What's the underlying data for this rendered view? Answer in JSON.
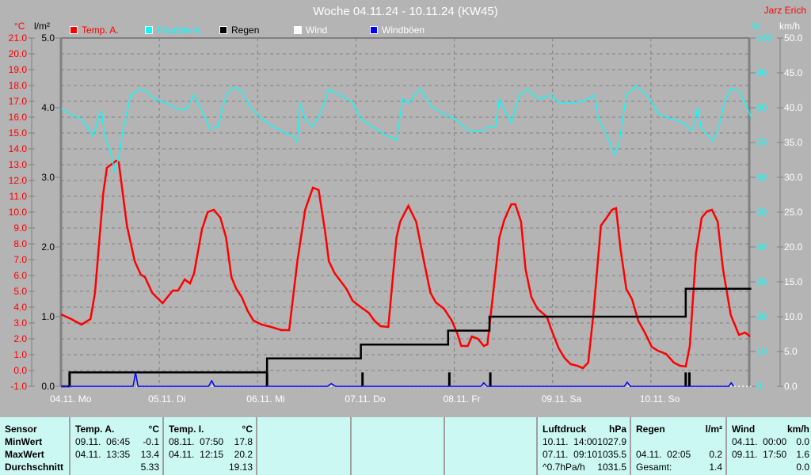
{
  "header": {
    "title": "Woche 04.11.24 - 10.11.24 (KW45)",
    "author": "Jarz Erich"
  },
  "legend": [
    {
      "label": "Temp. A.",
      "color": "#ff0000"
    },
    {
      "label": "Feuchte A.",
      "color": "#00ffff"
    },
    {
      "label": "Regen",
      "color": "#000000"
    },
    {
      "label": "Wind",
      "color": "#ffffff"
    },
    {
      "label": "Windböen",
      "color": "#0000ff"
    }
  ],
  "units": {
    "temp": "°C",
    "rain": "l/m²",
    "humidity": "%",
    "wind": "km/h"
  },
  "chart_data": {
    "type": "line",
    "title": "Woche 04.11.24 - 10.11.24 (KW45)",
    "x_unit": "hours since 04.11. 00:00",
    "xlim": [
      0,
      168
    ],
    "x_tick_labels": [
      "04.11. Mo",
      "05.11. Di",
      "06.11. Mi",
      "07.11. Do",
      "08.11. Fr",
      "09.11. Sa",
      "10.11. So"
    ],
    "axes": {
      "temp": {
        "range": [
          -1,
          21
        ],
        "ticks": [
          "-1.0",
          "0.0",
          "1.0",
          "2.0",
          "3.0",
          "4.0",
          "5.0",
          "6.0",
          "7.0",
          "8.0",
          "9.0",
          "10.0",
          "11.0",
          "12.0",
          "13.0",
          "14.0",
          "15.0",
          "16.0",
          "17.0",
          "18.0",
          "19.0",
          "20.0",
          "21.0"
        ]
      },
      "rain": {
        "range": [
          0,
          5
        ],
        "ticks": [
          "0.0",
          "1.0",
          "2.0",
          "3.0",
          "4.0",
          "5.0"
        ]
      },
      "humidity": {
        "range": [
          0,
          100
        ],
        "ticks": [
          "0",
          "10",
          "20",
          "30",
          "40",
          "50",
          "60",
          "70",
          "80",
          "90",
          "100"
        ]
      },
      "wind": {
        "range": [
          0,
          50
        ],
        "ticks": [
          "0.0",
          "5.0",
          "10.0",
          "15.0",
          "20.0",
          "25.0",
          "30.0",
          "35.0",
          "40.0",
          "45.0",
          "50.0"
        ]
      }
    },
    "grid": true,
    "series": [
      {
        "name": "Temp. A.",
        "axis": "temp",
        "color": "#ff0000",
        "points": [
          [
            0,
            3.55
          ],
          [
            2.5,
            3.25
          ],
          [
            5,
            2.9
          ],
          [
            7.2,
            3.25
          ],
          [
            8.3,
            4.9
          ],
          [
            10.3,
            11.15
          ],
          [
            11.2,
            12.8
          ],
          [
            13.5,
            13.25
          ],
          [
            14.1,
            13.15
          ],
          [
            16.1,
            9.15
          ],
          [
            18,
            6.9
          ],
          [
            19.5,
            6.05
          ],
          [
            20.5,
            5.9
          ],
          [
            22.3,
            4.9
          ],
          [
            24.8,
            4.25
          ],
          [
            27.3,
            5.05
          ],
          [
            28.6,
            5.05
          ],
          [
            30.2,
            5.75
          ],
          [
            31.5,
            5.5
          ],
          [
            32.5,
            6.15
          ],
          [
            34.4,
            8.9
          ],
          [
            35.8,
            10
          ],
          [
            37.3,
            10.15
          ],
          [
            38.9,
            9.65
          ],
          [
            40.3,
            8.4
          ],
          [
            41.6,
            5.9
          ],
          [
            42.8,
            5.15
          ],
          [
            44.1,
            4.65
          ],
          [
            45.5,
            3.8
          ],
          [
            47,
            3.15
          ],
          [
            49,
            2.9
          ],
          [
            51.3,
            2.75
          ],
          [
            53.8,
            2.55
          ],
          [
            55.7,
            2.55
          ],
          [
            57.7,
            6.9
          ],
          [
            59.6,
            10.15
          ],
          [
            61.5,
            11.55
          ],
          [
            62.9,
            11.4
          ],
          [
            64.4,
            8.9
          ],
          [
            65.4,
            6.9
          ],
          [
            66.8,
            6.15
          ],
          [
            69.7,
            5.15
          ],
          [
            71.2,
            4.4
          ],
          [
            73.2,
            4
          ],
          [
            75.1,
            3.65
          ],
          [
            76.5,
            3.15
          ],
          [
            78,
            2.8
          ],
          [
            79.9,
            2.75
          ],
          [
            81.9,
            8.4
          ],
          [
            82.8,
            9.4
          ],
          [
            84.8,
            10.4
          ],
          [
            86.7,
            9.4
          ],
          [
            88.6,
            6.9
          ],
          [
            90.2,
            4.9
          ],
          [
            91.5,
            4.3
          ],
          [
            93.5,
            3.9
          ],
          [
            95.4,
            3.15
          ],
          [
            96.8,
            2.3
          ],
          [
            97.7,
            1.55
          ],
          [
            99.3,
            1.55
          ],
          [
            100.3,
            2.15
          ],
          [
            101.8,
            2
          ],
          [
            103.2,
            1.55
          ],
          [
            104.1,
            1.65
          ],
          [
            105.5,
            4.9
          ],
          [
            107,
            8.4
          ],
          [
            108.2,
            9.5
          ],
          [
            109.9,
            10.5
          ],
          [
            110.9,
            10.5
          ],
          [
            112.3,
            9.4
          ],
          [
            113.4,
            6.4
          ],
          [
            114.8,
            4.65
          ],
          [
            116.3,
            3.9
          ],
          [
            118.6,
            3.4
          ],
          [
            119.6,
            2.65
          ],
          [
            121.5,
            1.4
          ],
          [
            122.9,
            0.8
          ],
          [
            124.4,
            0.4
          ],
          [
            126,
            0.3
          ],
          [
            127.4,
            0.15
          ],
          [
            128.7,
            0.5
          ],
          [
            129.9,
            3.4
          ],
          [
            131.8,
            9.15
          ],
          [
            133.2,
            9.65
          ],
          [
            134.5,
            10.15
          ],
          [
            135.5,
            10.25
          ],
          [
            136.6,
            7.65
          ],
          [
            138,
            5.15
          ],
          [
            139.4,
            4.5
          ],
          [
            140.9,
            3.15
          ],
          [
            142.5,
            2.4
          ],
          [
            144.2,
            1.5
          ],
          [
            145.7,
            1.25
          ],
          [
            147.7,
            1.05
          ],
          [
            149.6,
            0.5
          ],
          [
            151.1,
            0.3
          ],
          [
            152.5,
            0.25
          ],
          [
            153.5,
            1.55
          ],
          [
            155,
            7.4
          ],
          [
            156.4,
            9.65
          ],
          [
            157.7,
            10.05
          ],
          [
            158.9,
            10.15
          ],
          [
            160.3,
            9.4
          ],
          [
            161.6,
            6.4
          ],
          [
            163.5,
            3.5
          ],
          [
            165.5,
            2.25
          ],
          [
            167,
            2.4
          ],
          [
            168.2,
            2.15
          ]
        ]
      },
      {
        "name": "Feuchte A.",
        "axis": "humidity",
        "color": "#00ffff",
        "points": [
          [
            0,
            79.8
          ],
          [
            2.5,
            78
          ],
          [
            5,
            76.8
          ],
          [
            6.4,
            74.5
          ],
          [
            7.9,
            71.8
          ],
          [
            9.3,
            78
          ],
          [
            9.9,
            79
          ],
          [
            10.6,
            72.3
          ],
          [
            12.2,
            66.6
          ],
          [
            13.1,
            62
          ],
          [
            14.1,
            65.5
          ],
          [
            15.1,
            73.4
          ],
          [
            17,
            83.6
          ],
          [
            19,
            85.2
          ],
          [
            20.9,
            84.8
          ],
          [
            22.8,
            82.5
          ],
          [
            25.7,
            81.4
          ],
          [
            28.6,
            79.5
          ],
          [
            30.6,
            79.5
          ],
          [
            32.5,
            83.6
          ],
          [
            34.4,
            79
          ],
          [
            36.4,
            73.9
          ],
          [
            38.3,
            74.5
          ],
          [
            40.3,
            83.6
          ],
          [
            42.2,
            85.9
          ],
          [
            44.1,
            84.8
          ],
          [
            46.1,
            80.2
          ],
          [
            49,
            76.8
          ],
          [
            51.9,
            74.5
          ],
          [
            54.8,
            72.7
          ],
          [
            56.7,
            71.8
          ],
          [
            57.7,
            70
          ],
          [
            58.3,
            81.4
          ],
          [
            59.6,
            76.8
          ],
          [
            61.5,
            74.5
          ],
          [
            63.5,
            79
          ],
          [
            65.4,
            85.2
          ],
          [
            68.3,
            83.6
          ],
          [
            71.2,
            81.4
          ],
          [
            73.2,
            76.8
          ],
          [
            76.1,
            74.5
          ],
          [
            79,
            72.3
          ],
          [
            81.9,
            70.7
          ],
          [
            83.4,
            82.5
          ],
          [
            84.8,
            81.4
          ],
          [
            87.7,
            85.5
          ],
          [
            90.6,
            80.2
          ],
          [
            93.5,
            78
          ],
          [
            96.4,
            76.8
          ],
          [
            99.3,
            73.4
          ],
          [
            103.2,
            73.4
          ],
          [
            104.1,
            74.5
          ],
          [
            106.1,
            74.5
          ],
          [
            107,
            82.5
          ],
          [
            108.4,
            79
          ],
          [
            109.9,
            75.7
          ],
          [
            111.9,
            83.6
          ],
          [
            113.8,
            85.2
          ],
          [
            116.7,
            82.5
          ],
          [
            119.6,
            83.6
          ],
          [
            121.5,
            81.4
          ],
          [
            124.4,
            81.4
          ],
          [
            127.4,
            81.8
          ],
          [
            130.3,
            83.6
          ],
          [
            131.2,
            76.8
          ],
          [
            133.2,
            72.3
          ],
          [
            135.1,
            66.6
          ],
          [
            136.1,
            68.9
          ],
          [
            138,
            83.6
          ],
          [
            140.3,
            86.4
          ],
          [
            142.6,
            84.1
          ],
          [
            144.2,
            81.4
          ],
          [
            146.1,
            78
          ],
          [
            149,
            76.8
          ],
          [
            151.9,
            75.7
          ],
          [
            153.9,
            73.4
          ],
          [
            154.8,
            75.7
          ],
          [
            155.4,
            80.2
          ],
          [
            156.2,
            74.5
          ],
          [
            157.7,
            72.3
          ],
          [
            159.1,
            70.5
          ],
          [
            160.6,
            74.5
          ],
          [
            161.9,
            81.4
          ],
          [
            163.5,
            85.5
          ],
          [
            165.5,
            84.8
          ],
          [
            167.4,
            80.2
          ],
          [
            168.6,
            76.8
          ]
        ]
      },
      {
        "name": "Regen",
        "axis": "rain",
        "color": "#000000",
        "type": "step",
        "points": [
          [
            0,
            0
          ],
          [
            2.1,
            0.2
          ],
          [
            50.3,
            0.4
          ],
          [
            73.2,
            0.6
          ],
          [
            94.5,
            0.8
          ],
          [
            104.6,
            1.0
          ],
          [
            152.5,
            1.4
          ],
          [
            168.5,
            1.4
          ]
        ],
        "bars": [
          [
            2.1,
            0.2
          ],
          [
            50.3,
            0.2
          ],
          [
            73.6,
            0.2
          ],
          [
            94.8,
            0.2
          ],
          [
            104.8,
            0.2
          ],
          [
            152.5,
            0.2
          ],
          [
            153.4,
            0.2
          ]
        ]
      },
      {
        "name": "Wind",
        "axis": "wind",
        "color": "#ffffff",
        "points": [
          [
            0,
            0
          ],
          [
            168.5,
            0
          ]
        ]
      },
      {
        "name": "Windböen",
        "axis": "wind",
        "color": "#0000ff",
        "points": [
          [
            0,
            0
          ],
          [
            17.6,
            0
          ],
          [
            18.2,
            2
          ],
          [
            18.8,
            0
          ],
          [
            36,
            0
          ],
          [
            36.8,
            0.8
          ],
          [
            37.5,
            0
          ],
          [
            65,
            0
          ],
          [
            66,
            0.4
          ],
          [
            67,
            0
          ],
          [
            102.5,
            0
          ],
          [
            103.2,
            0.5
          ],
          [
            104,
            0
          ],
          [
            137.5,
            0
          ],
          [
            138.2,
            0.6
          ],
          [
            139,
            0
          ],
          [
            163,
            0
          ],
          [
            163.6,
            0.5
          ],
          [
            164.2,
            0
          ]
        ]
      }
    ]
  },
  "table": {
    "labels": {
      "sensor": "Sensor",
      "min": "MinWert",
      "max": "MaxWert",
      "avg": "Durchschnitt"
    },
    "temp_a": {
      "title": "Temp. A.",
      "unit": "°C",
      "min_time": "09.11.  06:45",
      "min": "-0.1",
      "max_time": "04.11.  13:35",
      "max": "13.4",
      "avg": "5.33"
    },
    "temp_i": {
      "title": "Temp. I.",
      "unit": "°C",
      "min_time": "08.11.  07:50",
      "min": "17.8",
      "max_time": "04.11.  12:15",
      "max": "20.2",
      "avg": "19.13"
    },
    "pressure": {
      "title": "Luftdruck",
      "unit": "hPa",
      "min_time": "10.11.  14:00",
      "min": "1027.9",
      "max_time": "07.11.  09:10",
      "max": "1035.5",
      "trend": "^0.7hPa/h",
      "avg": "1031.5"
    },
    "rain": {
      "title": "Regen",
      "unit": "l/m²",
      "max_time": "04.11.  02:05",
      "max": "0.2",
      "total_label": "Gesamt:",
      "total": "1.4"
    },
    "wind": {
      "title": "Wind",
      "unit": "km/h",
      "min_time": "04.11.  00:00",
      "min": "0.0",
      "max_time": "09.11.  17:50",
      "max": "1.6",
      "avg": "0.0"
    }
  }
}
